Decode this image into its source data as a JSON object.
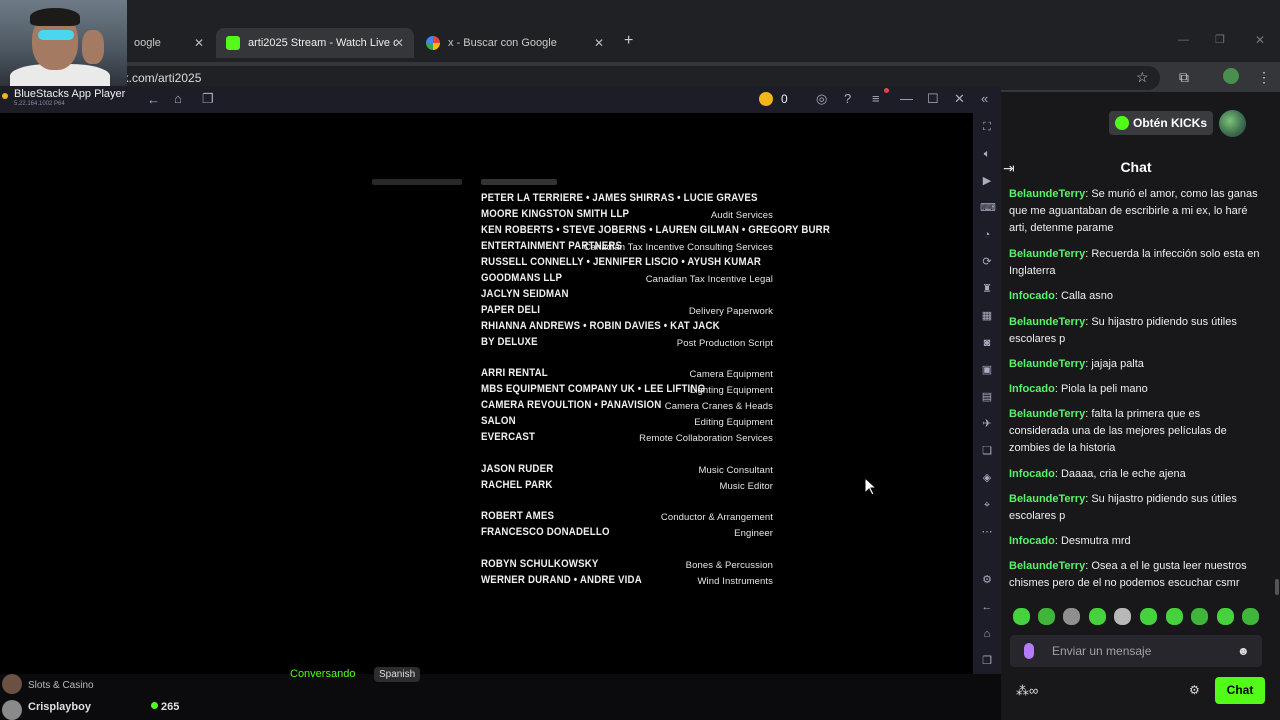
{
  "browser": {
    "tabs": [
      {
        "label": "oogle"
      },
      {
        "label": "arti2025 Stream - Watch Live o"
      },
      {
        "label": "x - Buscar con Google"
      }
    ],
    "url": "ick.com/arti2025",
    "new_tab_symbol": "+"
  },
  "bluestacks": {
    "title": "BlueStacks App Player",
    "version": "5.22.164.1002 P64",
    "coin_count": "0"
  },
  "credits": [
    {
      "role": "",
      "names": "PETER LA TERRIERE • JAMES SHIRRAS • LUCIE GRAVES"
    },
    {
      "role": "Audit Services",
      "names": "MOORE KINGSTON SMITH LLP"
    },
    {
      "role": "",
      "names": "KEN ROBERTS • STEVE JOBERNS • LAUREN GILMAN • GREGORY BURR"
    },
    {
      "role": "Canadian Tax Incentive Consulting Services",
      "names": "ENTERTAINMENT PARTNERS"
    },
    {
      "role": "",
      "names": "RUSSELL CONNELLY • JENNIFER LISCIO • AYUSH KUMAR"
    },
    {
      "role": "Canadian Tax Incentive Legal",
      "names": "GOODMANS LLP"
    },
    {
      "role": "",
      "names": "JACLYN SEIDMAN"
    },
    {
      "role": "Delivery Paperwork",
      "names": "PAPER DELI"
    },
    {
      "role": "",
      "names": "RHIANNA ANDREWS • ROBIN DAVIES • KAT JACK"
    },
    {
      "role": "Post Production Script",
      "names": "BY DELUXE"
    },
    {
      "role": "Camera Equipment",
      "names": "ARRI RENTAL"
    },
    {
      "role": "Lighting Equipment",
      "names": "MBS EQUIPMENT COMPANY UK • LEE LIFTING"
    },
    {
      "role": "Camera Cranes & Heads",
      "names": "CAMERA REVOULTION • PANAVISION"
    },
    {
      "role": "Editing Equipment",
      "names": "SALON"
    },
    {
      "role": "Remote Collaboration Services",
      "names": "EVERCAST"
    },
    {
      "role": "Music Consultant",
      "names": "JASON RUDER"
    },
    {
      "role": "Music Editor",
      "names": "RACHEL PARK"
    },
    {
      "role": "Conductor & Arrangement",
      "names": "ROBERT AMES"
    },
    {
      "role": "Engineer",
      "names": "FRANCESCO DONADELLO"
    },
    {
      "role": "Bones & Percussion",
      "names": "ROBYN SCHULKOWSKY"
    },
    {
      "role": "Wind Instruments",
      "names": "WERNER DURAND • ANDRE VIDA"
    }
  ],
  "chat": {
    "kicks_button": "Obtén KICKs",
    "title": "Chat",
    "messages": [
      {
        "user": "BelaundeTerry",
        "text": ": Se murió el amor, como las ganas que me aguantaban de escribirle a mi ex, lo haré arti, detenme parame"
      },
      {
        "user": "BelaundeTerry",
        "text": ": Recuerda la infección solo esta en Inglaterra"
      },
      {
        "user": "Infocado",
        "text": ": Calla asno"
      },
      {
        "user": "BelaundeTerry",
        "text": ": Su hijastro pidiendo sus útiles escolares p"
      },
      {
        "user": "BelaundeTerry",
        "text": ": jajaja palta"
      },
      {
        "user": "Infocado",
        "text": ": Piola la peli mano"
      },
      {
        "user": "BelaundeTerry",
        "text": ": falta la primera que es considerada una de las mejores películas de zombies de la historia"
      },
      {
        "user": "Infocado",
        "text": ": Daaaa, cria le eche ajena"
      },
      {
        "user": "BelaundeTerry",
        "text": ": Su hijastro pidiendo sus útiles escolares p"
      },
      {
        "user": "Infocado",
        "text": ": Desmutra mrd"
      },
      {
        "user": "BelaundeTerry",
        "text": ": Osea a el le gusta leer nuestros chismes pero de el no podemos escuchar csmr"
      }
    ],
    "input_placeholder": "Enviar un mensaje",
    "send_label": "Chat",
    "accent": "#53fc18"
  },
  "page_bottom": {
    "category": "Slots & Casino",
    "status": "Conversando",
    "language_tag": "Spanish",
    "channel": "Crisplayboy",
    "viewers": "265"
  }
}
